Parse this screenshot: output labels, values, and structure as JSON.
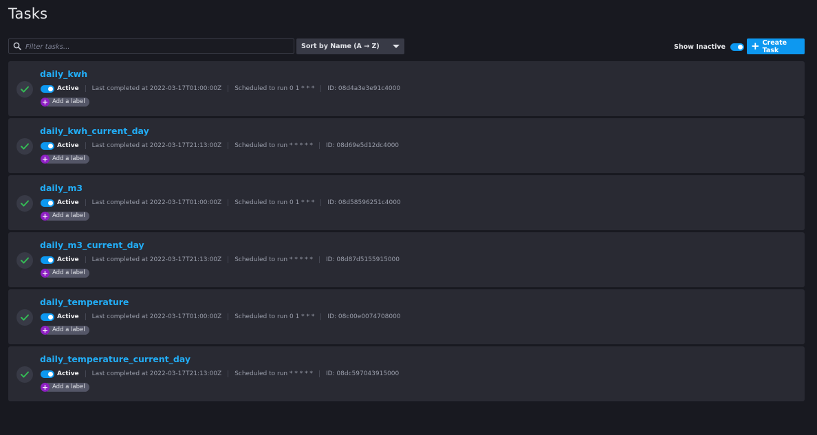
{
  "page": {
    "title": "Tasks"
  },
  "toolbar": {
    "search_placeholder": "Filter tasks...",
    "sort_label": "Sort by Name (A → Z)",
    "show_inactive_label": "Show Inactive",
    "show_inactive_on": true,
    "create_label": "Create Task"
  },
  "colors": {
    "accent": "#0d98f0",
    "link": "#22adf6",
    "success": "#34bb55",
    "label_purple": "#8e1fc3",
    "card_bg": "#292a33",
    "page_bg": "#181920"
  },
  "tasks": [
    {
      "name": "daily_kwh",
      "status_text": "Active",
      "last_completed": "Last completed at 2022-03-17T01:00:00Z",
      "schedule": "Scheduled to run 0 1 * * *",
      "id": "ID: 08d4a3e3e91c4000",
      "add_label": "Add a label"
    },
    {
      "name": "daily_kwh_current_day",
      "status_text": "Active",
      "last_completed": "Last completed at 2022-03-17T21:13:00Z",
      "schedule": "Scheduled to run * * * * *",
      "id": "ID: 08d69e5d12dc4000",
      "add_label": "Add a label"
    },
    {
      "name": "daily_m3",
      "status_text": "Active",
      "last_completed": "Last completed at 2022-03-17T01:00:00Z",
      "schedule": "Scheduled to run 0 1 * * *",
      "id": "ID: 08d58596251c4000",
      "add_label": "Add a label"
    },
    {
      "name": "daily_m3_current_day",
      "status_text": "Active",
      "last_completed": "Last completed at 2022-03-17T21:13:00Z",
      "schedule": "Scheduled to run * * * * *",
      "id": "ID: 08d87d5155915000",
      "add_label": "Add a label"
    },
    {
      "name": "daily_temperature",
      "status_text": "Active",
      "last_completed": "Last completed at 2022-03-17T01:00:00Z",
      "schedule": "Scheduled to run 0 1 * * *",
      "id": "ID: 08c00e0074708000",
      "add_label": "Add a label"
    },
    {
      "name": "daily_temperature_current_day",
      "status_text": "Active",
      "last_completed": "Last completed at 2022-03-17T21:13:00Z",
      "schedule": "Scheduled to run * * * * *",
      "id": "ID: 08dc597043915000",
      "add_label": "Add a label"
    }
  ]
}
